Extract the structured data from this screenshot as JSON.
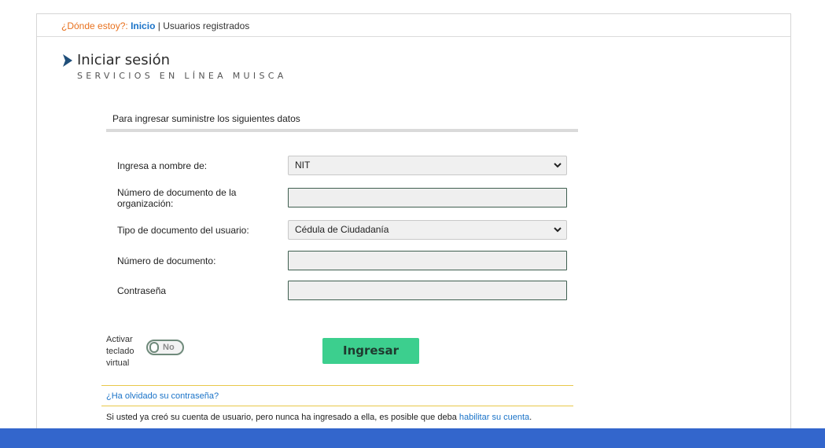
{
  "breadcrumb": {
    "where_label": "¿Dónde estoy?:",
    "home_link": "Inicio",
    "separator": "|",
    "current": "Usuarios registrados"
  },
  "header": {
    "title": "Iniciar sesión",
    "subtitle": "SERVICIOS EN LÍNEA MUISCA"
  },
  "form": {
    "instructions": "Para ingresar suministre los siguientes datos",
    "fields": [
      {
        "label": "Ingresa a nombre de:",
        "type": "select",
        "value": "NIT"
      },
      {
        "label": "Número de documento de la organización:",
        "type": "input",
        "value": ""
      },
      {
        "label": "Tipo de documento del usuario:",
        "type": "select",
        "value": "Cédula de Ciudadanía"
      },
      {
        "label": "Número de documento:",
        "type": "input",
        "value": ""
      },
      {
        "label": "Contraseña",
        "type": "password",
        "value": ""
      }
    ],
    "virtual_keyboard_label": "Activar teclado virtual",
    "virtual_keyboard_state": "No",
    "submit_label": "Ingresar"
  },
  "links": {
    "forgot_password": "¿Ha olvidado su contraseña?",
    "note_text": "Si usted ya creó su cuenta de usuario, pero nunca ha ingresado a ella, es posible que deba ",
    "note_link": "habilitar su cuenta",
    "note_end": "."
  },
  "colors": {
    "accent_link": "#1a73c8",
    "breadcrumb_where": "#e8711e",
    "button_bg": "#3ccf8e",
    "bottom_bar": "#3366cc",
    "divider_yellow": "#e8c84a"
  }
}
